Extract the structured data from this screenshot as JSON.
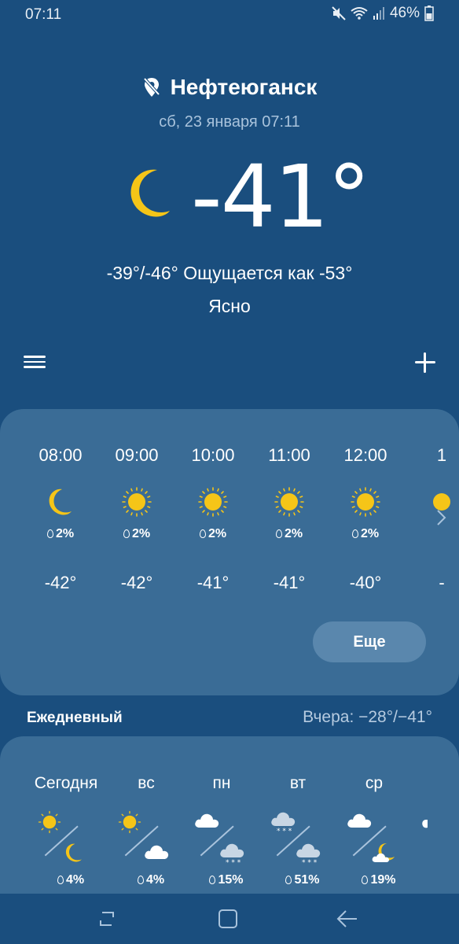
{
  "status": {
    "time": "07:11",
    "battery": "46%"
  },
  "location": {
    "city": "Нефтеюганск",
    "datetime": "сб, 23 января 07:11"
  },
  "current": {
    "temp": "-41°",
    "hilo_feels": "-39°/-46° Ощущается как -53°",
    "condition": "Ясно",
    "icon": "moon-icon"
  },
  "hourly": [
    {
      "time": "08:00",
      "icon": "moon-icon",
      "precip": "2%",
      "temp": "-42°"
    },
    {
      "time": "09:00",
      "icon": "sun-icon",
      "precip": "2%",
      "temp": "-42°"
    },
    {
      "time": "10:00",
      "icon": "sun-icon",
      "precip": "2%",
      "temp": "-41°"
    },
    {
      "time": "11:00",
      "icon": "sun-icon",
      "precip": "2%",
      "temp": "-41°"
    },
    {
      "time": "12:00",
      "icon": "sun-icon",
      "precip": "2%",
      "temp": "-40°"
    },
    {
      "time": "1",
      "icon": "sun-icon",
      "precip": "",
      "temp": "-"
    }
  ],
  "more_label": "Еще",
  "daily_header": "Ежедневный",
  "yesterday": "Вчера: −28°/−41°",
  "daily": [
    {
      "name": "Сегодня",
      "day_icon": "sun-icon",
      "night_icon": "moon-icon",
      "precip": "4%"
    },
    {
      "name": "вс",
      "day_icon": "sun-icon",
      "night_icon": "cloud-icon",
      "precip": "4%"
    },
    {
      "name": "пн",
      "day_icon": "cloud-icon",
      "night_icon": "snow-cloud-icon",
      "precip": "15%"
    },
    {
      "name": "вт",
      "day_icon": "snow-cloud-icon",
      "night_icon": "snow-cloud-icon",
      "precip": "51%"
    },
    {
      "name": "ср",
      "day_icon": "cloud-icon",
      "night_icon": "moon-cloud-icon",
      "precip": "19%"
    }
  ],
  "colors": {
    "background": "#1a4e7e",
    "card": "#3a6c96",
    "sun": "#f5c518"
  }
}
